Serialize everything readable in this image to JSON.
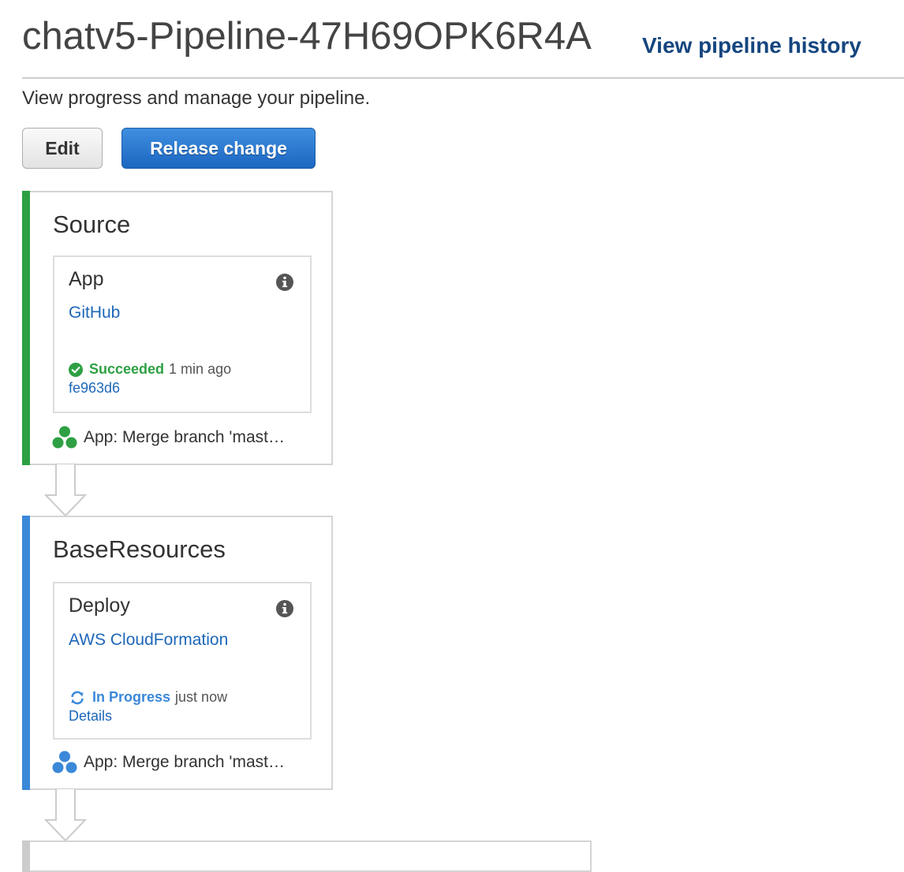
{
  "header": {
    "title": "chatv5-Pipeline-47H69OPK6R4A",
    "history_link": "View pipeline history",
    "subtitle": "View progress and manage your pipeline."
  },
  "toolbar": {
    "edit_label": "Edit",
    "release_label": "Release change"
  },
  "stages": [
    {
      "name": "Source",
      "status_color": "#2ea043",
      "action": {
        "name": "App",
        "info_icon": "info-icon",
        "provider": "GitHub",
        "status_icon": "check-circle-icon",
        "status": "Succeeded",
        "status_color": "#2ea043",
        "time": "1 min ago",
        "detail": "fe963d6"
      },
      "revision": "App: Merge branch 'mast…",
      "revision_icon": "revision-icon"
    },
    {
      "name": "BaseResources",
      "status_color": "#3b88d9",
      "action": {
        "name": "Deploy",
        "info_icon": "info-icon",
        "provider": "AWS CloudFormation",
        "status_icon": "refresh-icon",
        "status": "In Progress",
        "status_color": "#3b88d9",
        "time": "just now",
        "detail": "Details"
      },
      "revision": "App: Merge branch 'mast…",
      "revision_icon": "revision-icon"
    }
  ]
}
